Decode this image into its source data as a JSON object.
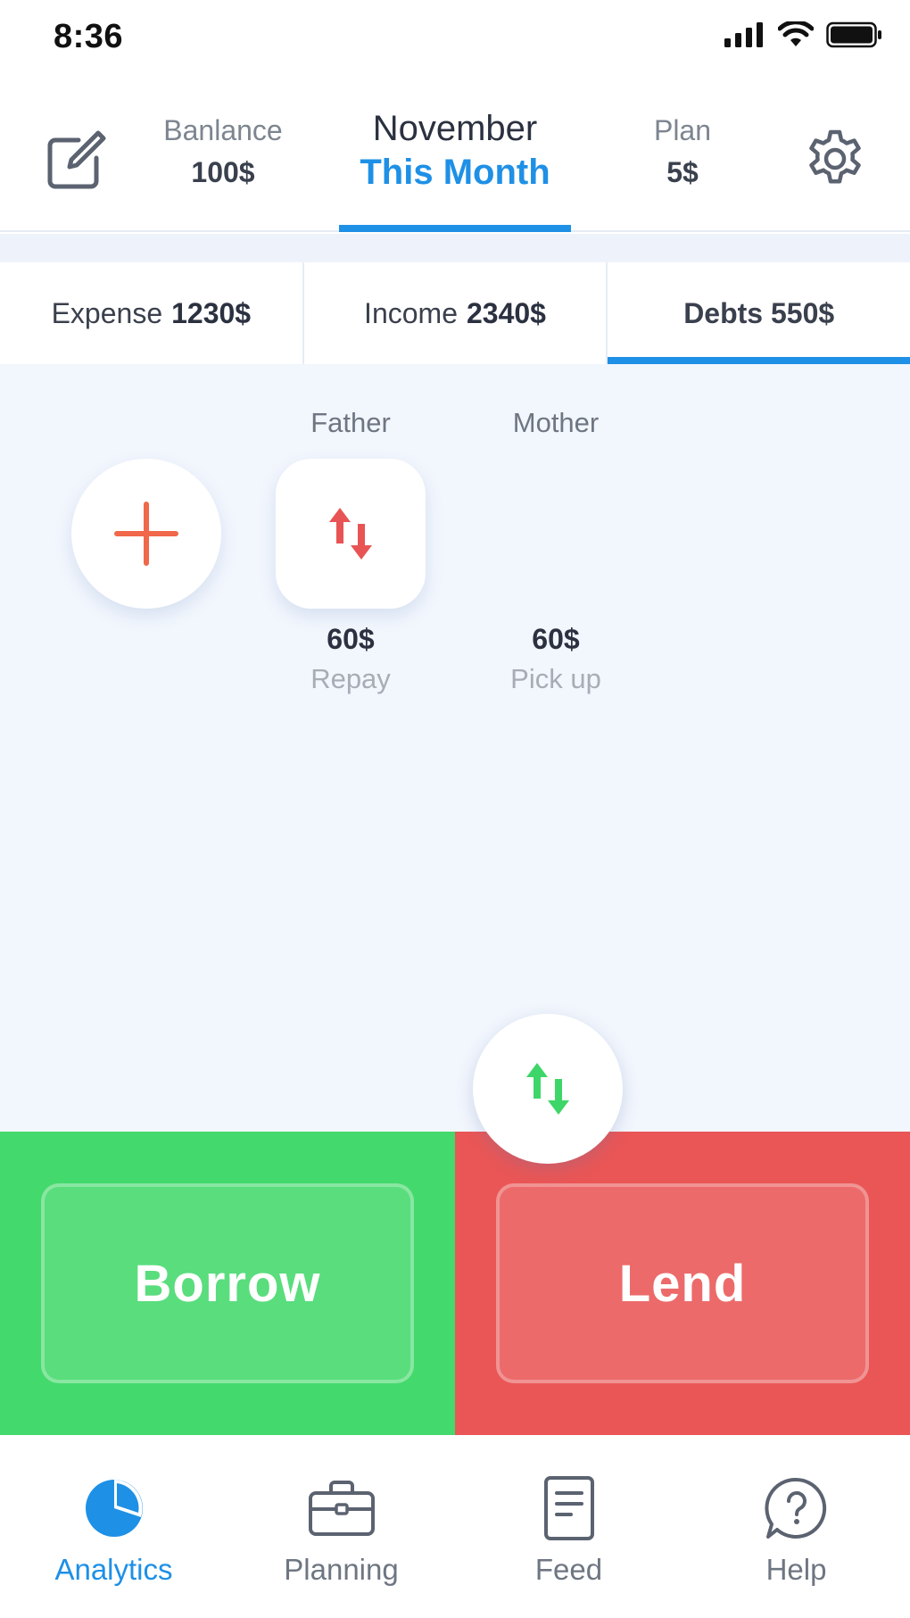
{
  "status_bar": {
    "time": "8:36"
  },
  "header": {
    "balance_label": "Banlance",
    "balance_value": "100$",
    "month": "November",
    "period": "This Month",
    "plan_label": "Plan",
    "plan_value": "5$"
  },
  "segments": [
    {
      "label": "Expense",
      "value": "1230$"
    },
    {
      "label": "Income",
      "value": "2340$"
    },
    {
      "label": "Debts 550$"
    }
  ],
  "debts": [
    {
      "name": "Father",
      "amount": "60$",
      "note": "Repay"
    },
    {
      "name": "Mother",
      "amount": "60$",
      "note": "Pick up"
    }
  ],
  "actions": {
    "borrow": "Borrow",
    "lend": "Lend"
  },
  "tabs": [
    {
      "label": "Analytics",
      "icon": "pie-chart-icon"
    },
    {
      "label": "Planning",
      "icon": "briefcase-icon"
    },
    {
      "label": "Feed",
      "icon": "document-icon"
    },
    {
      "label": "Help",
      "icon": "help-bubble-icon"
    }
  ],
  "colors": {
    "accent": "#1e90e6",
    "borrow": "#44d96c",
    "lend": "#ea5656",
    "add": "#f0674a",
    "swap": "#3ed668"
  }
}
